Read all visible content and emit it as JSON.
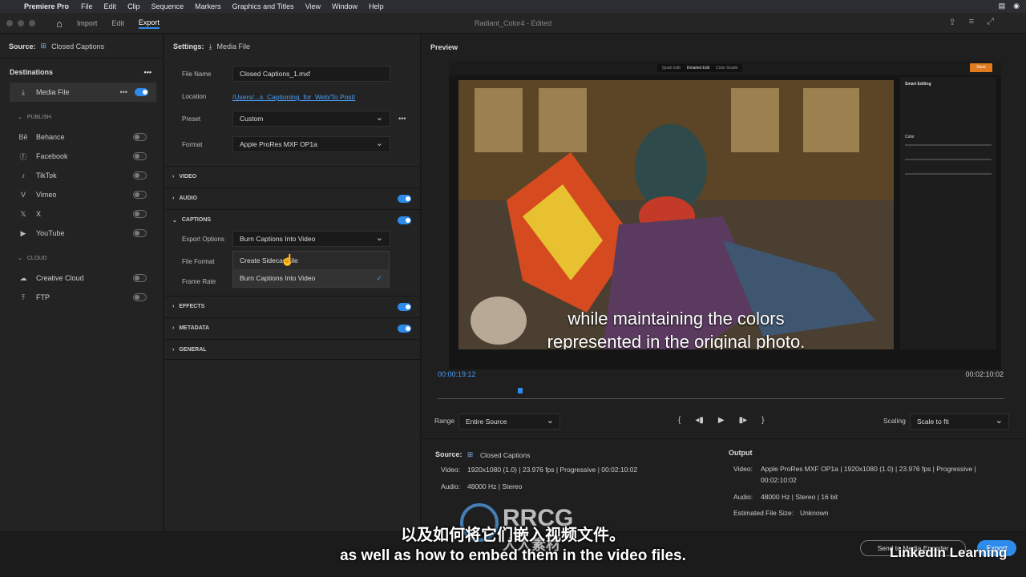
{
  "menubar": {
    "app": "Premiere Pro",
    "items": [
      "File",
      "Edit",
      "Clip",
      "Sequence",
      "Markers",
      "Graphics and Titles",
      "View",
      "Window",
      "Help"
    ]
  },
  "titlebar": {
    "tabs": [
      "Import",
      "Edit",
      "Export"
    ],
    "active_tab": "Export",
    "doc_title": "Radiant_Color4",
    "doc_state": "- Edited"
  },
  "left": {
    "source_label": "Source:",
    "source_value": "Closed Captions",
    "destinations_title": "Destinations",
    "media_file": "Media File",
    "publish_label": "PUBLISH",
    "publish_items": [
      "Behance",
      "Facebook",
      "TikTok",
      "Vimeo",
      "X",
      "YouTube"
    ],
    "cloud_label": "CLOUD",
    "cloud_items": [
      "Creative Cloud",
      "FTP"
    ]
  },
  "settings": {
    "title_label": "Settings:",
    "title_value": "Media File",
    "file_name_label": "File Name",
    "file_name_value": "Closed Captions_1.mxf",
    "location_label": "Location",
    "location_value": "/Users/...s_Captioning_for_Web/To Post/",
    "preset_label": "Preset",
    "preset_value": "Custom",
    "format_label": "Format",
    "format_value": "Apple ProRes MXF OP1a",
    "sections": {
      "video": "VIDEO",
      "audio": "AUDIO",
      "captions": "CAPTIONS",
      "effects": "EFFECTS",
      "metadata": "METADATA",
      "general": "GENERAL"
    },
    "export_options_label": "Export Options",
    "export_options_value": "Burn Captions Into Video",
    "file_format_label": "File Format",
    "frame_rate_label": "Frame Rate",
    "dropdown_options": [
      "Create Sidecar File",
      "Burn Captions Into Video"
    ]
  },
  "preview": {
    "title": "Preview",
    "caption_line1": "while maintaining the colors",
    "caption_line2": "represented in the original photo.",
    "tabs": [
      "Quick Edit",
      "Detailed Edit",
      "Color Grade"
    ],
    "save": "Save",
    "smart_editing": "Smart Editing",
    "color": "Color",
    "timecode_current": "00:00:19:12",
    "timecode_total": "00:02:10:02",
    "range_label": "Range",
    "range_value": "Entire Source",
    "scaling_label": "Scaling",
    "scaling_value": "Scale to fit"
  },
  "info": {
    "source_label": "Source:",
    "source_value": "Closed Captions",
    "source_video_label": "Video:",
    "source_video_value": "1920x1080 (1.0)  |  23.976 fps  |  Progressive  |  00:02:10:02",
    "source_audio_label": "Audio:",
    "source_audio_value": "48000 Hz  |  Stereo",
    "output_label": "Output",
    "out_video_label": "Video:",
    "out_video_value": "Apple ProRes MXF OP1a  |  1920x1080 (1.0)  |  23.976 fps  |  Progressive  |",
    "out_video_value2": "00:02:10:02",
    "out_audio_label": "Audio:",
    "out_audio_value": "48000 Hz  |  Stereo  |  16 bit",
    "est_size_label": "Estimated File Size:",
    "est_size_value": "Unknown"
  },
  "bottom": {
    "send_to_media_encoder": "Send to Media Encoder",
    "export": "Export"
  },
  "overlay": {
    "cn": "以及如何将它们嵌入视频文件。",
    "en": "as well as how to embed them in the video files.",
    "watermark": "RRCG",
    "watermark_cn": "人人素材",
    "brand": "LinkedIn Learning"
  },
  "colors": {
    "accent": "#2d8ceb",
    "save_orange": "#e07b20"
  }
}
